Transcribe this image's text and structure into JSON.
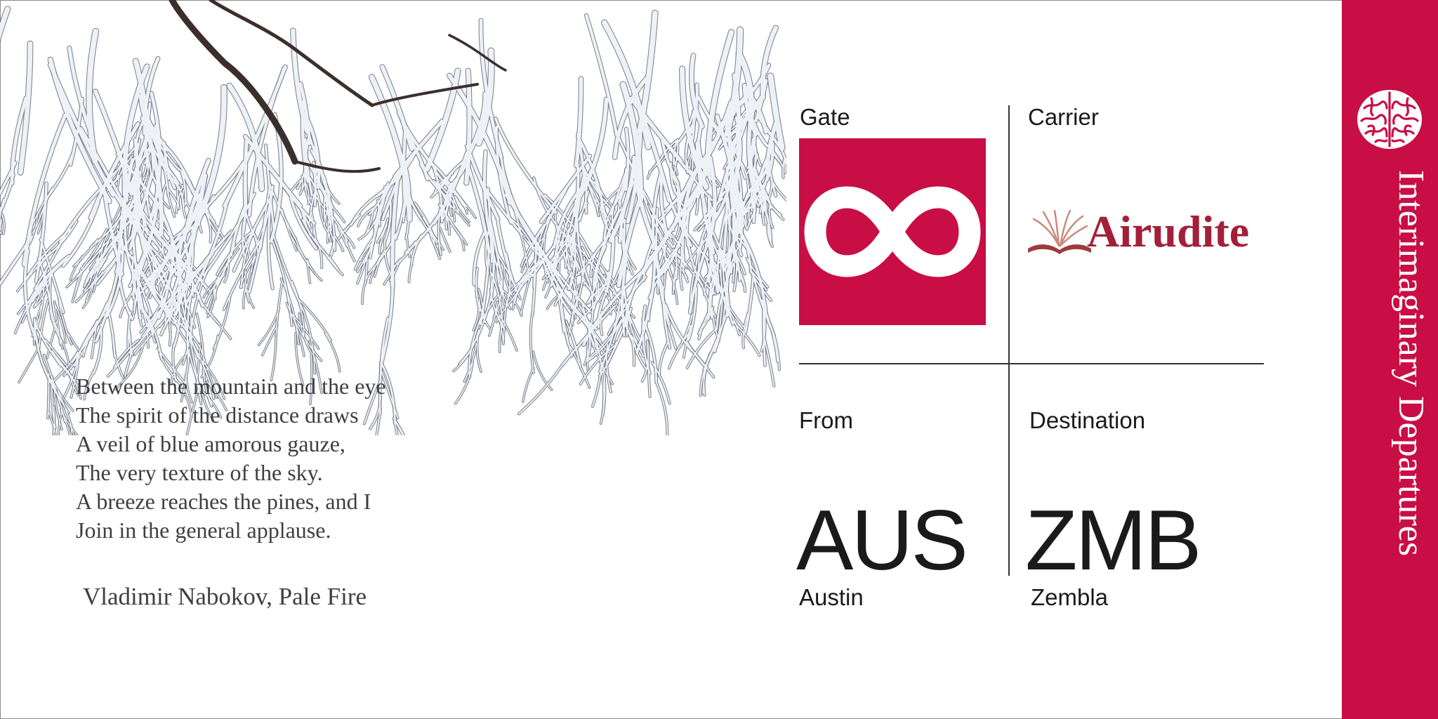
{
  "poem": {
    "lines": [
      "Between the mountain and the eye",
      "The spirit of the distance draws",
      "A veil of blue amorous gauze,",
      "The very texture of the sky.",
      "A breeze reaches the pines, and I",
      "Join in the general applause."
    ],
    "attribution": "Vladimir Nabokov, Pale Fire"
  },
  "ticket": {
    "gate_label": "Gate",
    "gate_icon": "infinity-icon",
    "carrier_label": "Carrier",
    "carrier_name": "Airudite",
    "carrier_logo_icon": "open-book-icon",
    "from_label": "From",
    "from_code": "AUS",
    "from_city": "Austin",
    "destination_label": "Destination",
    "destination_code": "ZMB",
    "destination_city": "Zembla"
  },
  "side_band": {
    "title": "Interimaginary Departures",
    "emblem_icon": "brain-icon"
  },
  "colors": {
    "accent": "#c90e45",
    "carrier_text": "#a3203a",
    "poem_text": "#3f3f3f",
    "ink": "#1a1a1a"
  }
}
